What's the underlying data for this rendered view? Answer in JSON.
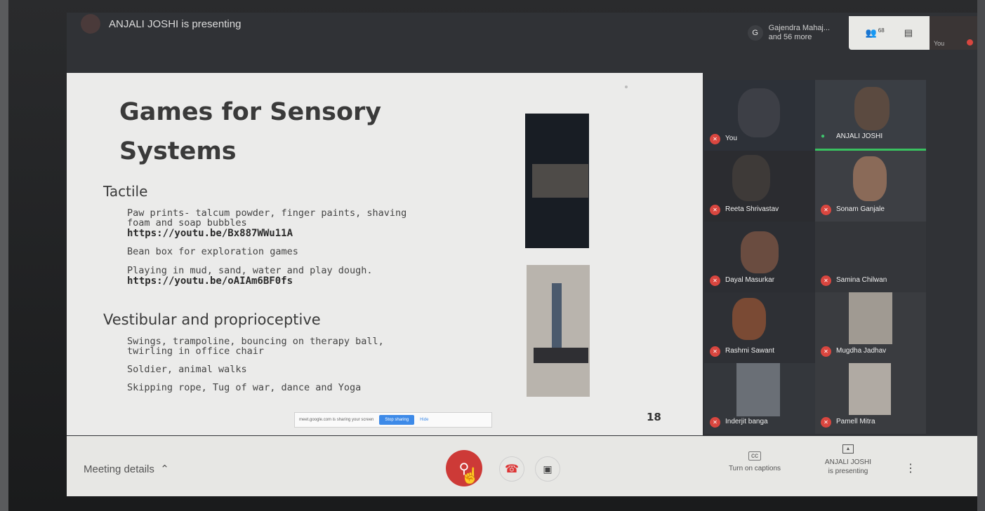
{
  "header": {
    "presenter_text": "ANJALI JOSHI is presenting",
    "others_avatar_letter": "G",
    "others_text": "Gajendra Mahaj... and 56 more",
    "participants_count": "68",
    "self_label": "You"
  },
  "slide": {
    "title_line1": "Games for Sensory",
    "title_line2": "Systems",
    "section1_heading": "Tactile",
    "section1_items": [
      "Paw prints- talcum powder, finger paints, shaving",
      "foam and soap bubbles",
      "https://youtu.be/Bx887WWu11A",
      "Bean box for exploration games",
      "Playing in mud, sand, water and play dough.",
      "https://youtu.be/oAIAm6BF0fs"
    ],
    "section2_heading": "Vestibular and proprioceptive",
    "section2_items": [
      "Swings, trampoline, bouncing on therapy  ball,",
      "twirling in office chair",
      "Soldier, animal walks",
      "Skipping rope, Tug of war, dance and Yoga"
    ],
    "page_number": "18",
    "share_bar_text": "meet.google.com is sharing your screen",
    "stop_sharing_label": "Stop sharing",
    "hide_label": "Hide"
  },
  "participants": [
    {
      "name": "You",
      "muted": true
    },
    {
      "name": "ANJALI JOSHI",
      "muted": false,
      "speaking": true
    },
    {
      "name": "Reeta Shrivastav",
      "muted": true
    },
    {
      "name": "Sonam Ganjale",
      "muted": true
    },
    {
      "name": "Dayal Masurkar",
      "muted": true
    },
    {
      "name": "Samina Chilwan",
      "muted": true
    },
    {
      "name": "Rashmi Sawant",
      "muted": true
    },
    {
      "name": "Mugdha Jadhav",
      "muted": true
    },
    {
      "name": "Inderjit banga",
      "muted": true
    },
    {
      "name": "Pamell Mitra",
      "muted": true
    }
  ],
  "bottom_bar": {
    "meeting_details_label": "Meeting details",
    "captions_label": "Turn on captions",
    "presenting_line1": "ANJALI JOSHI",
    "presenting_line2": "is presenting"
  },
  "colors": {
    "mic_muted": "#cd3a37",
    "speaking_indicator": "#39c160",
    "stop_sharing": "#3d8ae8"
  }
}
